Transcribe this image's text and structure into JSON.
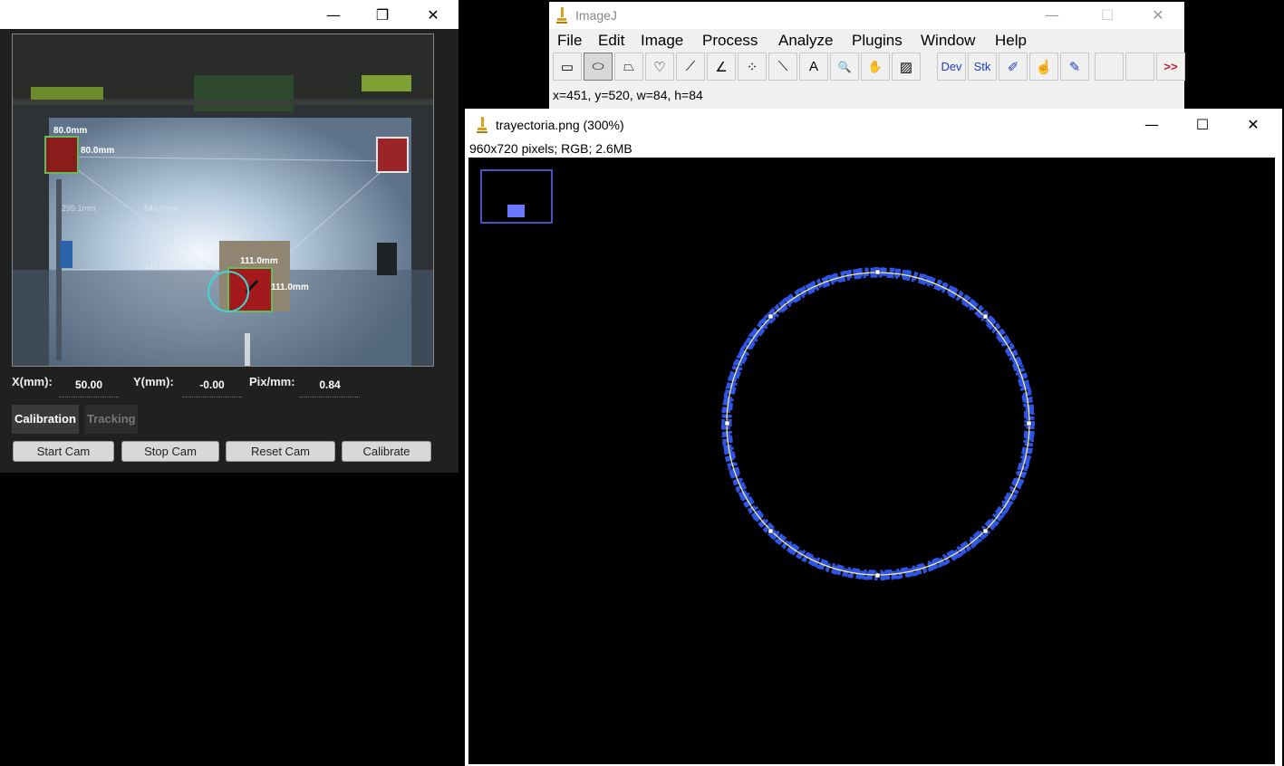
{
  "camera_app": {
    "overlay": {
      "label_80_w": "80.0mm",
      "label_80_h": "80.0mm",
      "label_299": "299.1mm",
      "label_540": "540.0mm",
      "label_449": "449.0mm",
      "label_111_w": "111.0mm",
      "label_111_h": "111.0mm"
    },
    "coords": {
      "x_label": "X(mm):",
      "x_value": "50.00",
      "y_label": "Y(mm):",
      "y_value": "-0.00",
      "pix_label": "Pix/mm:",
      "pix_value": "0.84"
    },
    "tabs": [
      "Calibration",
      "Tracking"
    ],
    "buttons": [
      "Start Cam",
      "Stop Cam",
      "Reset Cam",
      "Calibrate"
    ]
  },
  "imagej": {
    "title": "ImageJ",
    "menus": [
      "File",
      "Edit",
      "Image",
      "Process",
      "Analyze",
      "Plugins",
      "Window",
      "Help"
    ],
    "tools": [
      {
        "name": "rectangle-tool-icon",
        "glyph": "▭"
      },
      {
        "name": "oval-tool-icon",
        "glyph": "⬭"
      },
      {
        "name": "polygon-tool-icon",
        "glyph": "⏢"
      },
      {
        "name": "freehand-tool-icon",
        "glyph": "♡"
      },
      {
        "name": "line-tool-icon",
        "glyph": "⟋"
      },
      {
        "name": "angle-tool-icon",
        "glyph": "∠"
      },
      {
        "name": "multipoint-tool-icon",
        "glyph": "⁘"
      },
      {
        "name": "wand-tool-icon",
        "glyph": "⟍"
      },
      {
        "name": "text-tool-icon",
        "glyph": "A"
      },
      {
        "name": "magnifier-tool-icon",
        "glyph": "🔍"
      },
      {
        "name": "hand-tool-icon",
        "glyph": "✋"
      },
      {
        "name": "color-picker-tool-icon",
        "glyph": "▨"
      }
    ],
    "tool_dev": "Dev",
    "tool_stk": "Stk",
    "more_tools": ">>",
    "status": "x=451, y=520, w=84, h=84"
  },
  "image_window": {
    "title": "trayectoria.png (300%)",
    "info": "960x720 pixels; RGB; 2.6MB"
  },
  "colors": {
    "trace_blue": "#2f55e8",
    "fit_yellow": "#f5f08a",
    "ij_icon": "#d9a21b"
  }
}
